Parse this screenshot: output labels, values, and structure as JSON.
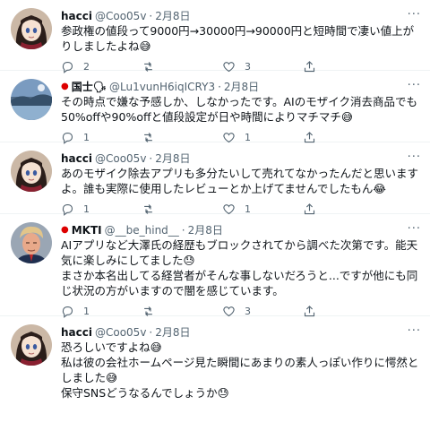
{
  "tweets": [
    {
      "name": "hacci",
      "flag": "",
      "handle": "@Coo05v",
      "date": "2月8日",
      "text": "参政権の値段って9000円→30000円→90000円と短時間で凄い値上がりしましたよね😅",
      "replies": "2",
      "retweets": "",
      "likes": "3",
      "avatar": "anime-girl"
    },
    {
      "name": "国士🗣",
      "flag": "●",
      "handle": "@Lu1vunH6iqICRY3",
      "date": "2月8日",
      "text": "その時点で嫌な予感しか、しなかったです。AIのモザイク消去商品でも50%offや90%offと値段設定が日や時間によりマチマチ😅",
      "replies": "1",
      "retweets": "",
      "likes": "1",
      "avatar": "landscape"
    },
    {
      "name": "hacci",
      "flag": "",
      "handle": "@Coo05v",
      "date": "2月8日",
      "text": "あのモザイク除去アプリも多分たいして売れてなかったんだと思いますよ。誰も実際に使用したレビューとか上げてませんでしたもん😂",
      "replies": "1",
      "retweets": "",
      "likes": "1",
      "avatar": "anime-girl"
    },
    {
      "name": "MKTI",
      "flag": "●",
      "handle": "@__be_hind__",
      "date": "2月8日",
      "text": "AIアプリなど大澤氏の経歴もブロックされてから調べた次第です。能天気に楽しみにしてました😓\nまさか本名出してる経営者がそんな事しないだろうと...ですが他にも同じ状況の方がいますので闇を感じています。",
      "replies": "1",
      "retweets": "",
      "likes": "3",
      "avatar": "man-portrait"
    },
    {
      "name": "hacci",
      "flag": "",
      "handle": "@Coo05v",
      "date": "2月8日",
      "text": "恐ろしいですよね😅\n私は彼の会社ホームページ見た瞬間にあまりの素人っぽい作りに愕然としました😅\n保守SNSどうなるんでしょうか😓",
      "replies": "",
      "retweets": "",
      "likes": "",
      "avatar": "anime-girl"
    }
  ],
  "icons": {
    "reply": "reply-icon",
    "retweet": "retweet-icon",
    "like": "heart-icon",
    "share": "share-icon",
    "more": "more-icon"
  },
  "colors": {
    "text": "#0f1419",
    "muted": "#536471",
    "divider": "#eff3f4"
  }
}
